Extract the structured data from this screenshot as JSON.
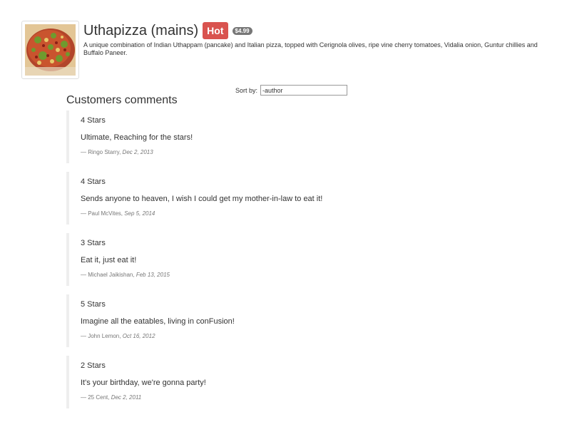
{
  "dish": {
    "name": "Uthapizza (mains)",
    "label": "Hot",
    "price": "$4.99",
    "description": "A unique combination of Indian Uthappam (pancake) and Italian pizza, topped with Cerignola olives, ripe vine cherry tomatoes, Vidalia onion, Guntur chillies and Buffalo Paneer."
  },
  "comments_section": {
    "title": "Customers comments",
    "sort_label": "Sort by:",
    "sort_value": "-author"
  },
  "comments": [
    {
      "stars": "4 Stars",
      "text": "Ultimate, Reaching for the stars!",
      "author": "— Ringo Starry,",
      "date": "Dec 2, 2013"
    },
    {
      "stars": "4 Stars",
      "text": "Sends anyone to heaven, I wish I could get my mother-in-law to eat it!",
      "author": "— Paul McVites,",
      "date": "Sep 5, 2014"
    },
    {
      "stars": "3 Stars",
      "text": "Eat it, just eat it!",
      "author": "— Michael Jaikishan,",
      "date": "Feb 13, 2015"
    },
    {
      "stars": "5 Stars",
      "text": "Imagine all the eatables, living in conFusion!",
      "author": "— John Lemon,",
      "date": "Oct 16, 2012"
    },
    {
      "stars": "2 Stars",
      "text": "It's your birthday, we're gonna party!",
      "author": "— 25 Cent,",
      "date": "Dec 2, 2011"
    }
  ],
  "colors": {
    "hot_label": "#d9534f",
    "price_badge": "#777777",
    "quote_border": "#eeeeee"
  }
}
